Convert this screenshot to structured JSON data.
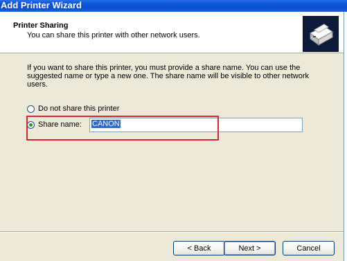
{
  "window": {
    "title": "Add Printer Wizard"
  },
  "header": {
    "title": "Printer Sharing",
    "subtitle": "You can share this printer with other network users."
  },
  "body": {
    "description": "If you want to share this printer, you must provide a share name. You can use the suggested name or type a new one. The share name will be visible to other network users.",
    "options": {
      "no_share_label": "Do not share this printer",
      "share_label": "Share name:",
      "selected": "share"
    },
    "share_name_value": "CANON"
  },
  "buttons": {
    "back": "< Back",
    "next": "Next >",
    "cancel": "Cancel"
  },
  "colors": {
    "titlebar": "#0b4fcf",
    "dialog_bg": "#ece9d8",
    "highlight": "#e0202c",
    "selection": "#316ac5"
  },
  "icons": {
    "header": "printer-icon"
  }
}
